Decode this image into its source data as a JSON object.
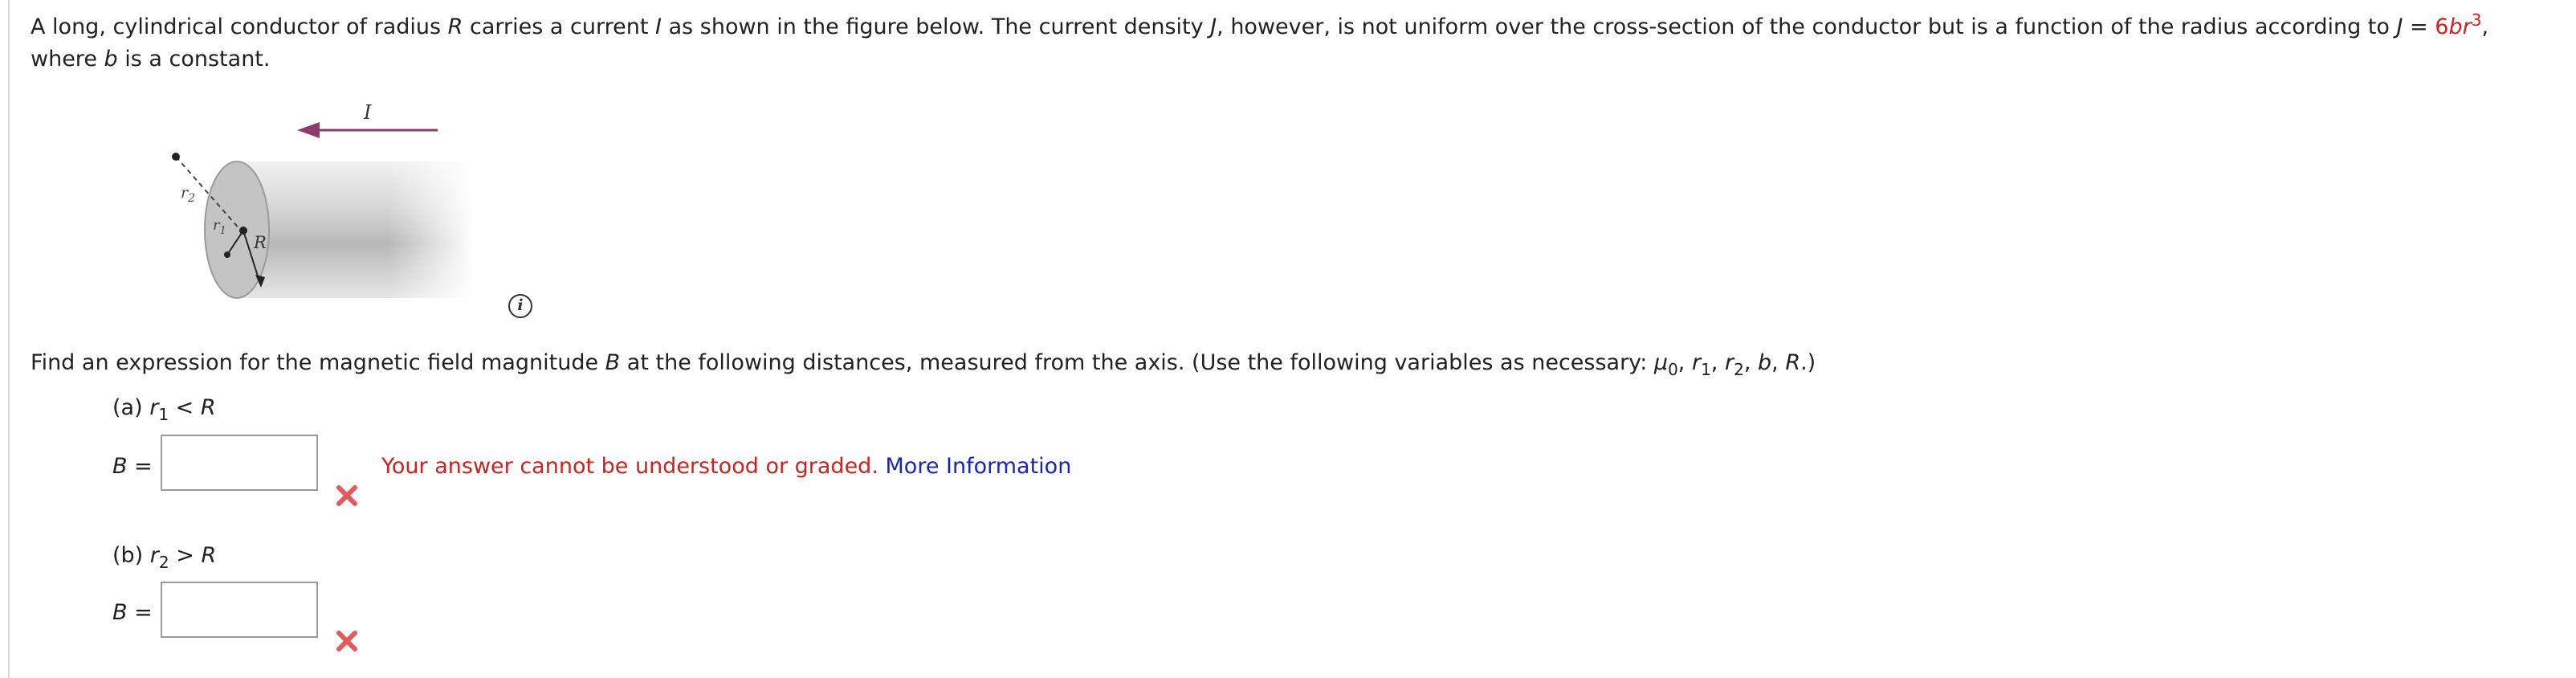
{
  "problem": {
    "t1": "A long, cylindrical conductor of radius ",
    "R": "R",
    "t2": " carries a current ",
    "I": "I",
    "t3": " as shown in the figure below. The current density ",
    "J": "J",
    "t4": ", however, is not uniform over the cross-section of the conductor but is a function of the radius according to ",
    "J2": "J",
    "eq": " = ",
    "coef": "6",
    "b": "b",
    "r": "r",
    "exp": "3",
    "t5": ", where ",
    "b2": "b",
    "t6": " is a constant."
  },
  "figure": {
    "current_label": "I",
    "r1_label": "r",
    "r1_sub": "1",
    "r2_label": "r",
    "r2_sub": "2",
    "R_label": "R",
    "arrow_color": "#8e3a6c"
  },
  "info_icon": "i",
  "find": {
    "t1": "Find an expression for the magnetic field magnitude ",
    "B": "B",
    "t2": " at the following distances, measured from the axis. (Use the following variables as necessary: ",
    "mu": "μ",
    "mu_sub": "0",
    "c1": ", ",
    "r1": "r",
    "r1_sub": "1",
    "c2": ", ",
    "r2": "r",
    "r2_sub": "2",
    "c3": ", ",
    "b": "b",
    "c4": ", ",
    "R": "R",
    "end": ".)"
  },
  "part_a": {
    "label": "(a) ",
    "r": "r",
    "sub": "1",
    "rel": " < ",
    "R": "R",
    "b_label": "B",
    "b_eq": " =",
    "value": "",
    "error_msg": "Your answer cannot be understood or graded.",
    "more_info": "More Information"
  },
  "part_b": {
    "label": "(b) ",
    "r": "r",
    "sub": "2",
    "rel": " > ",
    "R": "R",
    "b_label": "B",
    "b_eq": " =",
    "value": ""
  },
  "colors": {
    "error_red": "#cc2222",
    "link_blue": "#1a24b5",
    "x_mark": "#e05c5c"
  }
}
